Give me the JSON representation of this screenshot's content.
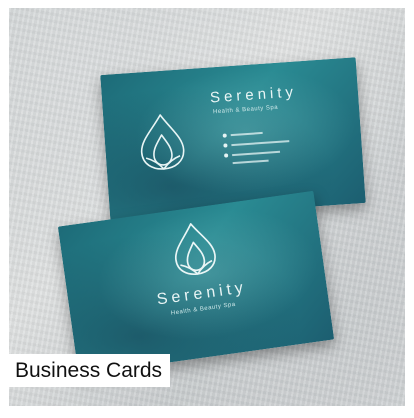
{
  "product": {
    "caption": "Business Cards",
    "brand_name": "Serenity",
    "brand_tagline": "Health & Beauty Spa"
  },
  "colors": {
    "card_teal": "#1d6b78",
    "caption_bg": "#ffffff",
    "caption_text": "#111111"
  },
  "icons": [
    "drop-logo-icon",
    "phone-icon",
    "email-icon",
    "location-icon"
  ]
}
